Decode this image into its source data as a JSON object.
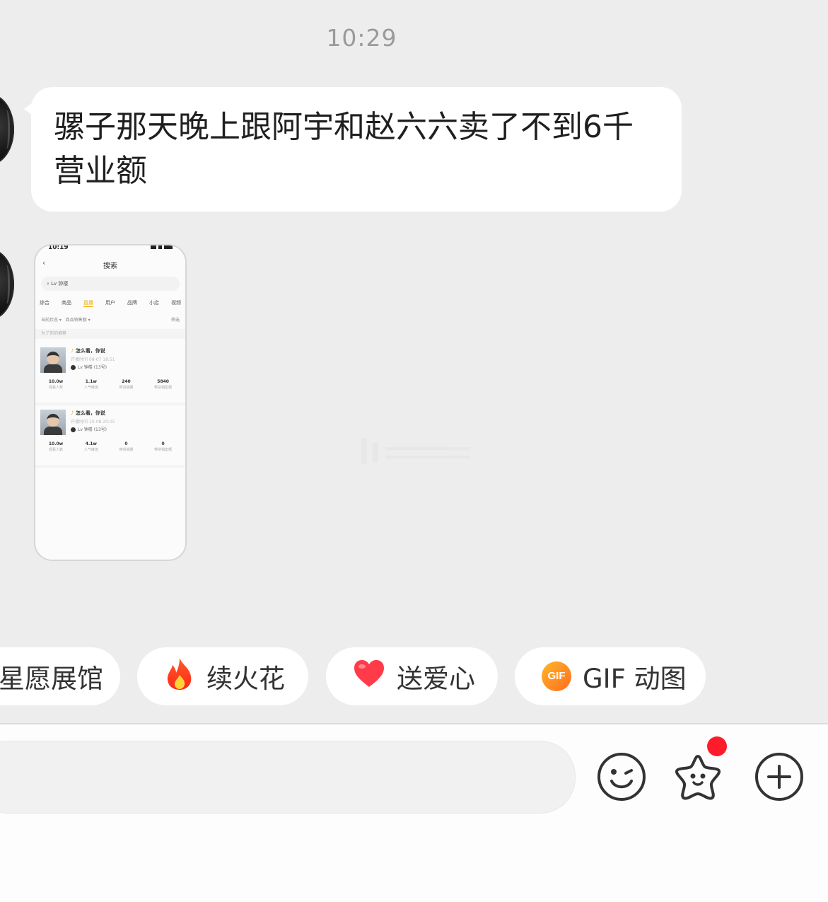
{
  "chat": {
    "timestamp": "10:29",
    "message_text": "骡子那天晚上跟阿宇和赵六六卖了不到6千营业额"
  },
  "shared_screenshot": {
    "status_time": "10:19",
    "title": "搜索",
    "search_text": "Lv 钟楼",
    "tabs": [
      "综合",
      "商品",
      "直播",
      "用户",
      "品牌",
      "小店",
      "视频"
    ],
    "active_tab_index": 2,
    "filters": [
      "当前状态",
      "商品销售额"
    ],
    "filter_right": "筛选",
    "hint": "为了你的推荐",
    "cards": [
      {
        "name": "怎么看，你说",
        "sub": "开播时间 08-07 18:51",
        "shop": "Lv 钟楼 (13号)",
        "stats": [
          {
            "value": "10.0w",
            "label": "观看人数"
          },
          {
            "value": "1.1w",
            "label": "人气峰值"
          },
          {
            "value": "240",
            "label": "带货销量"
          },
          {
            "value": "5840",
            "label": "带货销售额"
          }
        ]
      },
      {
        "name": "怎么看，你说",
        "sub": "开播时间 10-08 20:05",
        "shop": "Lv 钟楼 (13号)",
        "stats": [
          {
            "value": "10.0w",
            "label": "观看人数"
          },
          {
            "value": "4.1w",
            "label": "人气峰值"
          },
          {
            "value": "0",
            "label": "带货销量"
          },
          {
            "value": "0",
            "label": "带货销售额"
          }
        ]
      }
    ]
  },
  "quick_actions": [
    {
      "label": "星愿展馆",
      "icon": "none"
    },
    {
      "label": "续火花",
      "icon": "flame-icon"
    },
    {
      "label": "送爱心",
      "icon": "heart-icon"
    },
    {
      "label": "GIF 动图",
      "icon": "gif-icon",
      "icon_text": "GIF"
    }
  ],
  "input_bar": {
    "placeholder": "",
    "tools": [
      "emoji-icon",
      "star-face-icon",
      "add-icon"
    ],
    "badge_color": "#ff1c2a"
  },
  "colors": {
    "background": "#ededed",
    "bubble": "#ffffff",
    "accent": "#f5a800"
  }
}
